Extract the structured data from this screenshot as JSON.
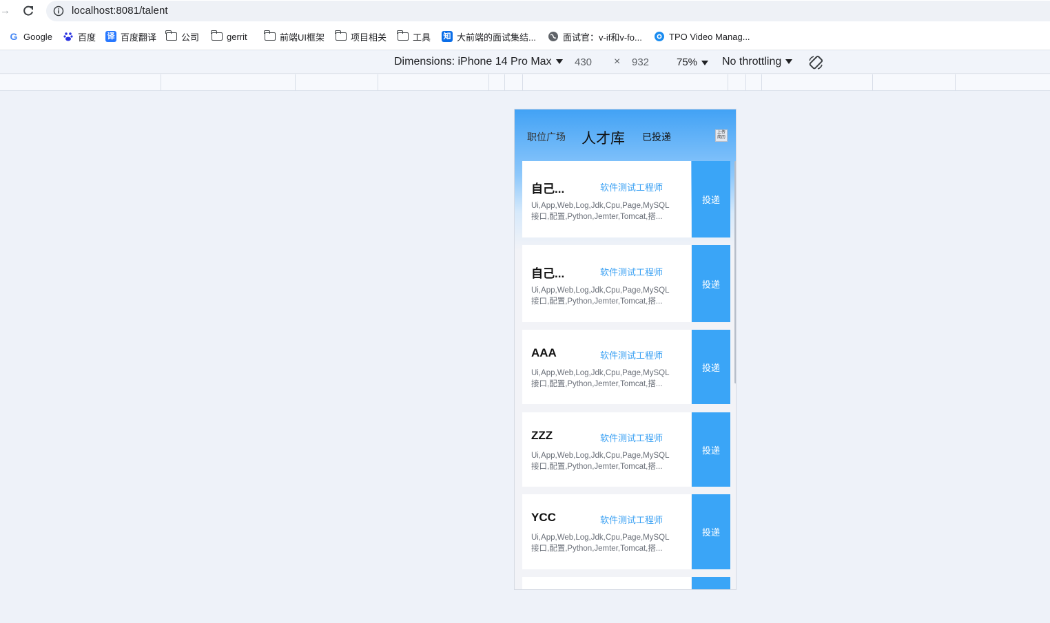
{
  "browser": {
    "url": "localhost:8081/talent",
    "bookmarks": [
      {
        "label": "Google",
        "icon": "google-icon"
      },
      {
        "label": "百度",
        "icon": "baidu-icon"
      },
      {
        "label": "百度翻译",
        "icon": "translate-icon"
      },
      {
        "label": "公司",
        "icon": "folder-icon"
      },
      {
        "label": "gerrit",
        "icon": "folder-icon"
      },
      {
        "label": "前端UI框架",
        "icon": "folder-icon"
      },
      {
        "label": "项目相关",
        "icon": "folder-icon"
      },
      {
        "label": "工具",
        "icon": "folder-icon"
      },
      {
        "label": "大前端的面试集结...",
        "icon": "zhihu-icon"
      },
      {
        "label": "面试官：v-if和v-fo...",
        "icon": "globe-icon"
      },
      {
        "label": "TPO Video Manag...",
        "icon": "tpo-icon"
      }
    ]
  },
  "devtools": {
    "dimensions_label": "Dimensions: iPhone 14 Pro Max",
    "width": "430",
    "times": "×",
    "height": "932",
    "zoom": "75%",
    "throttling": "No throttling"
  },
  "app": {
    "tabs": {
      "plaza": "职位广场",
      "talent": "人才库",
      "sent": "已投递"
    },
    "upload_label": "上传简历",
    "deliver_label": "投递",
    "cards": [
      {
        "name": "自己...",
        "job": "软件测试工程师",
        "skills_line1": "Ui,App,Web,Log,Jdk,Cpu,Page,MySQL",
        "skills_line2": "接口,配置,Python,Jemter,Tomcat,搭..."
      },
      {
        "name": "自己...",
        "job": "软件测试工程师",
        "skills_line1": "Ui,App,Web,Log,Jdk,Cpu,Page,MySQL",
        "skills_line2": "接口,配置,Python,Jemter,Tomcat,搭..."
      },
      {
        "name": "AAA",
        "job": "软件测试工程师",
        "skills_line1": "Ui,App,Web,Log,Jdk,Cpu,Page,MySQL",
        "skills_line2": "接口,配置,Python,Jemter,Tomcat,搭..."
      },
      {
        "name": "ZZZ",
        "job": "软件测试工程师",
        "skills_line1": "Ui,App,Web,Log,Jdk,Cpu,Page,MySQL",
        "skills_line2": "接口,配置,Python,Jemter,Tomcat,搭..."
      },
      {
        "name": "YCC",
        "job": "软件测试工程师",
        "skills_line1": "Ui,App,Web,Log,Jdk,Cpu,Page,MySQL",
        "skills_line2": "接口,配置,Python,Jemter,Tomcat,搭..."
      }
    ]
  },
  "colors": {
    "accent": "#3aa5f7",
    "job_text": "#3ba1f3",
    "page_bg": "#eef2f9"
  }
}
